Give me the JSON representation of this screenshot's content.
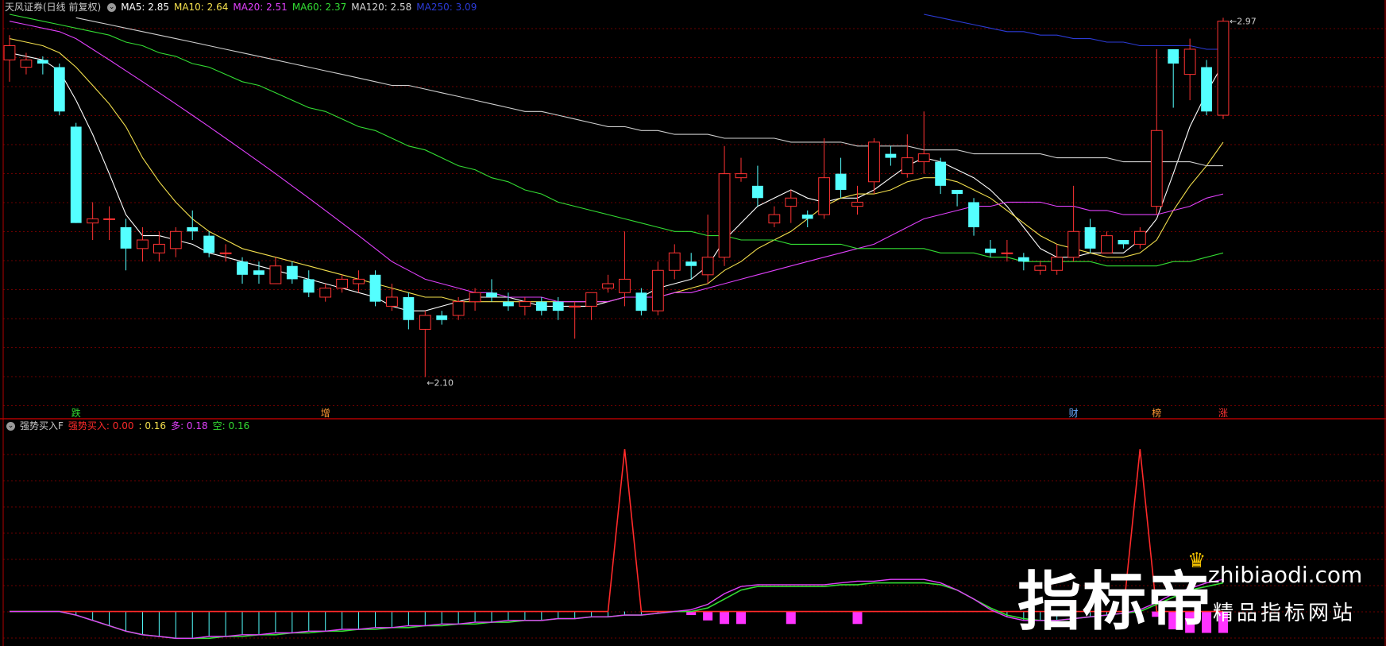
{
  "header": {
    "title": "天风证券(日线 前复权)",
    "ma": [
      {
        "label": "MA5: 2.85",
        "color": "#ffffff"
      },
      {
        "label": "MA10: 2.64",
        "color": "#f4e04d"
      },
      {
        "label": "MA20: 2.51",
        "color": "#e040fb"
      },
      {
        "label": "MA60: 2.37",
        "color": "#33dd33"
      },
      {
        "label": "MA120: 2.58",
        "color": "#d8d8d8"
      },
      {
        "label": "MA250: 3.09",
        "color": "#2b3bd6"
      }
    ]
  },
  "indicator_header": {
    "name": "强势买入F",
    "items": [
      {
        "label": "强势买入: 0.00",
        "color": "#ff2a2a"
      },
      {
        "label": ": 0.16",
        "color": "#f4e04d"
      },
      {
        "label": "多: 0.18",
        "color": "#e040fb"
      },
      {
        "label": "空: 0.16",
        "color": "#33dd33"
      }
    ]
  },
  "chart_data": {
    "type": "candlestick",
    "y_scale": "log",
    "ylim": [
      2.04,
      2.99
    ],
    "high_label": "2.97",
    "low_label": "2.10",
    "candles": [
      [
        2.86,
        2.9,
        2.93,
        2.8
      ],
      [
        2.84,
        2.86,
        2.88,
        2.82
      ],
      [
        2.86,
        2.85,
        2.87,
        2.82
      ],
      [
        2.84,
        2.72,
        2.85,
        2.71
      ],
      [
        2.68,
        2.44,
        2.69,
        2.44
      ],
      [
        2.44,
        2.45,
        2.49,
        2.4
      ],
      [
        2.45,
        2.45,
        2.48,
        2.4
      ],
      [
        2.43,
        2.38,
        2.45,
        2.33
      ],
      [
        2.38,
        2.4,
        2.43,
        2.35
      ],
      [
        2.37,
        2.39,
        2.42,
        2.35
      ],
      [
        2.38,
        2.42,
        2.43,
        2.36
      ],
      [
        2.43,
        2.42,
        2.47,
        2.4
      ],
      [
        2.41,
        2.37,
        2.42,
        2.36
      ],
      [
        2.37,
        2.37,
        2.39,
        2.35
      ],
      [
        2.35,
        2.32,
        2.36,
        2.3
      ],
      [
        2.33,
        2.32,
        2.35,
        2.3
      ],
      [
        2.3,
        2.34,
        2.36,
        2.3
      ],
      [
        2.34,
        2.31,
        2.35,
        2.3
      ],
      [
        2.31,
        2.28,
        2.33,
        2.27
      ],
      [
        2.27,
        2.29,
        2.3,
        2.26
      ],
      [
        2.29,
        2.31,
        2.32,
        2.28
      ],
      [
        2.3,
        2.31,
        2.33,
        2.28
      ],
      [
        2.32,
        2.26,
        2.33,
        2.25
      ],
      [
        2.25,
        2.27,
        2.3,
        2.24
      ],
      [
        2.27,
        2.22,
        2.28,
        2.2
      ],
      [
        2.2,
        2.23,
        2.24,
        2.1
      ],
      [
        2.23,
        2.22,
        2.24,
        2.21
      ],
      [
        2.23,
        2.26,
        2.27,
        2.22
      ],
      [
        2.26,
        2.28,
        2.29,
        2.24
      ],
      [
        2.28,
        2.27,
        2.31,
        2.26
      ],
      [
        2.26,
        2.25,
        2.28,
        2.24
      ],
      [
        2.25,
        2.26,
        2.27,
        2.23
      ],
      [
        2.26,
        2.24,
        2.27,
        2.23
      ],
      [
        2.26,
        2.24,
        2.27,
        2.22
      ],
      [
        2.25,
        2.25,
        2.26,
        2.18
      ],
      [
        2.25,
        2.28,
        2.28,
        2.22
      ],
      [
        2.29,
        2.3,
        2.32,
        2.28
      ],
      [
        2.28,
        2.31,
        2.42,
        2.25
      ],
      [
        2.28,
        2.24,
        2.29,
        2.23
      ],
      [
        2.24,
        2.33,
        2.35,
        2.23
      ],
      [
        2.33,
        2.37,
        2.39,
        2.31
      ],
      [
        2.35,
        2.34,
        2.37,
        2.31
      ],
      [
        2.32,
        2.36,
        2.46,
        2.3
      ],
      [
        2.36,
        2.56,
        2.63,
        2.34
      ],
      [
        2.55,
        2.56,
        2.6,
        2.54
      ],
      [
        2.53,
        2.5,
        2.58,
        2.48
      ],
      [
        2.44,
        2.46,
        2.48,
        2.43
      ],
      [
        2.48,
        2.5,
        2.52,
        2.44
      ],
      [
        2.46,
        2.45,
        2.47,
        2.43
      ],
      [
        2.46,
        2.55,
        2.65,
        2.45
      ],
      [
        2.56,
        2.52,
        2.6,
        2.5
      ],
      [
        2.48,
        2.49,
        2.53,
        2.46
      ],
      [
        2.54,
        2.64,
        2.65,
        2.51
      ],
      [
        2.61,
        2.6,
        2.63,
        2.58
      ],
      [
        2.56,
        2.6,
        2.66,
        2.55
      ],
      [
        2.59,
        2.61,
        2.72,
        2.56
      ],
      [
        2.59,
        2.53,
        2.6,
        2.51
      ],
      [
        2.52,
        2.51,
        2.52,
        2.48
      ],
      [
        2.49,
        2.43,
        2.5,
        2.41
      ],
      [
        2.38,
        2.37,
        2.4,
        2.36
      ],
      [
        2.37,
        2.37,
        2.4,
        2.35
      ],
      [
        2.36,
        2.35,
        2.37,
        2.33
      ],
      [
        2.33,
        2.34,
        2.35,
        2.32
      ],
      [
        2.33,
        2.36,
        2.39,
        2.32
      ],
      [
        2.36,
        2.42,
        2.53,
        2.35
      ],
      [
        2.43,
        2.38,
        2.45,
        2.37
      ],
      [
        2.37,
        2.41,
        2.42,
        2.37
      ],
      [
        2.4,
        2.39,
        2.4,
        2.38
      ],
      [
        2.39,
        2.42,
        2.43,
        2.38
      ],
      [
        2.48,
        2.67,
        2.89,
        2.46
      ],
      [
        2.89,
        2.85,
        2.89,
        2.73
      ],
      [
        2.82,
        2.89,
        2.92,
        2.75
      ],
      [
        2.84,
        2.72,
        2.86,
        2.71
      ],
      [
        2.71,
        2.97,
        2.98,
        2.7
      ]
    ],
    "ma": {
      "MA5": [
        2.88,
        2.87,
        2.86,
        2.83,
        2.75,
        2.66,
        2.56,
        2.46,
        2.41,
        2.41,
        2.4,
        2.39,
        2.37,
        2.36,
        2.35,
        2.34,
        2.33,
        2.32,
        2.31,
        2.3,
        2.29,
        2.28,
        2.27,
        2.25,
        2.24,
        2.24,
        2.25,
        2.26,
        2.27,
        2.27,
        2.27,
        2.26,
        2.25,
        2.25,
        2.25,
        2.25,
        2.26,
        2.27,
        2.27,
        2.29,
        2.3,
        2.31,
        2.34,
        2.4,
        2.44,
        2.48,
        2.5,
        2.52,
        2.5,
        2.49,
        2.5,
        2.5,
        2.52,
        2.55,
        2.58,
        2.6,
        2.59,
        2.57,
        2.55,
        2.52,
        2.48,
        2.43,
        2.38,
        2.36,
        2.36,
        2.37,
        2.37,
        2.37,
        2.4,
        2.45,
        2.56,
        2.68,
        2.77,
        2.85
      ],
      "MA10": [
        2.92,
        2.91,
        2.9,
        2.88,
        2.84,
        2.79,
        2.74,
        2.68,
        2.6,
        2.54,
        2.49,
        2.45,
        2.42,
        2.4,
        2.38,
        2.37,
        2.36,
        2.35,
        2.34,
        2.33,
        2.32,
        2.31,
        2.3,
        2.29,
        2.28,
        2.27,
        2.27,
        2.26,
        2.26,
        2.26,
        2.26,
        2.26,
        2.26,
        2.26,
        2.26,
        2.26,
        2.26,
        2.27,
        2.27,
        2.27,
        2.28,
        2.29,
        2.3,
        2.33,
        2.35,
        2.38,
        2.4,
        2.42,
        2.45,
        2.48,
        2.5,
        2.51,
        2.51,
        2.52,
        2.54,
        2.55,
        2.55,
        2.54,
        2.52,
        2.5,
        2.47,
        2.44,
        2.41,
        2.39,
        2.38,
        2.37,
        2.36,
        2.36,
        2.37,
        2.4,
        2.47,
        2.53,
        2.58,
        2.64
      ],
      "MA20": [
        2.97,
        2.96,
        2.95,
        2.94,
        2.92,
        2.89,
        2.86,
        2.83,
        2.8,
        2.77,
        2.74,
        2.71,
        2.68,
        2.65,
        2.62,
        2.59,
        2.56,
        2.53,
        2.5,
        2.47,
        2.44,
        2.41,
        2.38,
        2.35,
        2.33,
        2.31,
        2.3,
        2.29,
        2.28,
        2.28,
        2.27,
        2.27,
        2.27,
        2.26,
        2.26,
        2.26,
        2.26,
        2.27,
        2.27,
        2.27,
        2.28,
        2.28,
        2.29,
        2.3,
        2.31,
        2.32,
        2.33,
        2.34,
        2.35,
        2.36,
        2.37,
        2.38,
        2.39,
        2.41,
        2.43,
        2.45,
        2.46,
        2.47,
        2.48,
        2.48,
        2.49,
        2.49,
        2.49,
        2.48,
        2.48,
        2.47,
        2.47,
        2.46,
        2.46,
        2.46,
        2.47,
        2.48,
        2.5,
        2.51
      ],
      "MA60": [
        2.99,
        2.98,
        2.97,
        2.96,
        2.95,
        2.94,
        2.93,
        2.91,
        2.9,
        2.88,
        2.87,
        2.85,
        2.84,
        2.82,
        2.8,
        2.79,
        2.77,
        2.75,
        2.73,
        2.72,
        2.7,
        2.68,
        2.67,
        2.65,
        2.63,
        2.62,
        2.6,
        2.58,
        2.57,
        2.55,
        2.54,
        2.52,
        2.51,
        2.49,
        2.48,
        2.47,
        2.46,
        2.45,
        2.44,
        2.43,
        2.42,
        2.42,
        2.41,
        2.41,
        2.4,
        2.4,
        2.4,
        2.39,
        2.39,
        2.39,
        2.39,
        2.38,
        2.38,
        2.38,
        2.38,
        2.38,
        2.37,
        2.37,
        2.37,
        2.36,
        2.36,
        2.35,
        2.35,
        2.35,
        2.35,
        2.35,
        2.34,
        2.34,
        2.34,
        2.34,
        2.35,
        2.35,
        2.36,
        2.37
      ],
      "MA120": [
        null,
        null,
        null,
        null,
        2.98,
        2.97,
        2.96,
        2.95,
        2.94,
        2.93,
        2.92,
        2.91,
        2.9,
        2.89,
        2.88,
        2.87,
        2.86,
        2.85,
        2.84,
        2.83,
        2.82,
        2.81,
        2.8,
        2.79,
        2.79,
        2.78,
        2.77,
        2.76,
        2.75,
        2.74,
        2.73,
        2.72,
        2.72,
        2.71,
        2.7,
        2.69,
        2.68,
        2.68,
        2.67,
        2.67,
        2.66,
        2.66,
        2.66,
        2.65,
        2.65,
        2.65,
        2.65,
        2.64,
        2.64,
        2.64,
        2.64,
        2.63,
        2.63,
        2.63,
        2.63,
        2.62,
        2.62,
        2.62,
        2.61,
        2.61,
        2.61,
        2.61,
        2.61,
        2.6,
        2.6,
        2.6,
        2.6,
        2.59,
        2.59,
        2.59,
        2.59,
        2.59,
        2.58,
        2.58
      ],
      "MA250": [
        null,
        null,
        null,
        null,
        null,
        null,
        null,
        null,
        null,
        null,
        null,
        null,
        null,
        null,
        null,
        null,
        null,
        null,
        null,
        null,
        null,
        null,
        null,
        null,
        null,
        null,
        null,
        null,
        null,
        null,
        null,
        null,
        null,
        null,
        null,
        null,
        null,
        null,
        null,
        null,
        null,
        null,
        null,
        null,
        null,
        null,
        null,
        null,
        null,
        null,
        null,
        null,
        null,
        null,
        null,
        2.99,
        2.98,
        2.97,
        2.96,
        2.95,
        2.94,
        2.94,
        2.93,
        2.93,
        2.92,
        2.92,
        2.91,
        2.91,
        2.9,
        2.9,
        2.9,
        2.9,
        2.89,
        2.89
      ]
    },
    "event_markers": [
      {
        "index": 4,
        "label": "跌",
        "color": "#33dd33"
      },
      {
        "index": 19,
        "label": "增",
        "color": "#ff9933"
      },
      {
        "index": 64,
        "label": "财",
        "color": "#66aaff"
      },
      {
        "index": 69,
        "label": "榜",
        "color": "#ff9933"
      },
      {
        "index": 73,
        "label": "涨",
        "color": "#ff3333"
      }
    ],
    "indicator": {
      "ylim": [
        -0.18,
        1.0
      ],
      "strong_buy": [
        0,
        0,
        0,
        0,
        0,
        0,
        0,
        0,
        0,
        0,
        0,
        0,
        0,
        0,
        0,
        0,
        0,
        0,
        0,
        0,
        0,
        0,
        0,
        0,
        0,
        0,
        0,
        0,
        0,
        0,
        0,
        0,
        0,
        0,
        0,
        0,
        0,
        1,
        0,
        0,
        0,
        0,
        0,
        0,
        0,
        0,
        0,
        0,
        0,
        0,
        0,
        0,
        0,
        0,
        0,
        0,
        0,
        0,
        0,
        0,
        0,
        0,
        0,
        0,
        0,
        0,
        0,
        0,
        1,
        0,
        0,
        0,
        0,
        0
      ],
      "long": [
        0,
        0,
        0,
        0,
        -0.02,
        -0.05,
        -0.08,
        -0.11,
        -0.13,
        -0.14,
        -0.15,
        -0.15,
        -0.14,
        -0.14,
        -0.13,
        -0.13,
        -0.12,
        -0.12,
        -0.11,
        -0.11,
        -0.1,
        -0.1,
        -0.09,
        -0.09,
        -0.08,
        -0.08,
        -0.07,
        -0.07,
        -0.06,
        -0.06,
        -0.05,
        -0.05,
        -0.05,
        -0.04,
        -0.04,
        -0.03,
        -0.03,
        -0.02,
        -0.02,
        -0.01,
        0.0,
        0.01,
        0.04,
        0.1,
        0.14,
        0.15,
        0.15,
        0.15,
        0.15,
        0.15,
        0.16,
        0.17,
        0.17,
        0.18,
        0.18,
        0.18,
        0.16,
        0.12,
        0.07,
        0.01,
        -0.03,
        -0.05,
        -0.05,
        -0.05,
        -0.04,
        -0.03,
        -0.02,
        -0.01,
        0.01,
        0.05,
        0.1,
        0.13,
        0.16,
        0.18
      ],
      "short": [
        0,
        0,
        0,
        0,
        -0.02,
        -0.05,
        -0.08,
        -0.11,
        -0.13,
        -0.14,
        -0.15,
        -0.15,
        -0.15,
        -0.14,
        -0.14,
        -0.13,
        -0.13,
        -0.12,
        -0.12,
        -0.11,
        -0.11,
        -0.1,
        -0.1,
        -0.09,
        -0.09,
        -0.08,
        -0.08,
        -0.07,
        -0.07,
        -0.06,
        -0.06,
        -0.05,
        -0.05,
        -0.04,
        -0.04,
        -0.03,
        -0.03,
        -0.02,
        -0.02,
        -0.01,
        0.0,
        0.0,
        0.02,
        0.07,
        0.12,
        0.14,
        0.14,
        0.14,
        0.14,
        0.14,
        0.15,
        0.15,
        0.16,
        0.16,
        0.16,
        0.16,
        0.15,
        0.12,
        0.07,
        0.02,
        -0.02,
        -0.04,
        -0.05,
        -0.05,
        -0.04,
        -0.03,
        -0.02,
        -0.01,
        0.0,
        0.04,
        0.08,
        0.12,
        0.14,
        0.16
      ],
      "bars": [
        0,
        0,
        0,
        0,
        0,
        0,
        0,
        0,
        0,
        0,
        0,
        0,
        0,
        0,
        0,
        0,
        0,
        0,
        0,
        0,
        0,
        0,
        0,
        0,
        0,
        0,
        0,
        0,
        0,
        0,
        0,
        0,
        0,
        0,
        0,
        0,
        0,
        0,
        0,
        0,
        0,
        -0.02,
        -0.05,
        -0.07,
        -0.07,
        0,
        0,
        -0.07,
        0,
        0,
        0,
        -0.07,
        0,
        0,
        0,
        0,
        0,
        0,
        0,
        0,
        0,
        0,
        0,
        0,
        0,
        0,
        0,
        0,
        0,
        -0.03,
        -0.1,
        -0.12,
        -0.12,
        -0.12
      ]
    },
    "colors": {
      "up": "#ff3333",
      "down": "#54ffff",
      "grid": "#6b0000",
      "frame": "#b00000",
      "strong_buy": "#ff2a2a",
      "long": "#e040fb",
      "short": "#33dd33",
      "bar": "#ff33ff",
      "stem": "#54ffff"
    }
  },
  "watermark": {
    "brand": "指标帝",
    "url": "zhibiaodi.com",
    "tagline": "精品指标网站"
  }
}
